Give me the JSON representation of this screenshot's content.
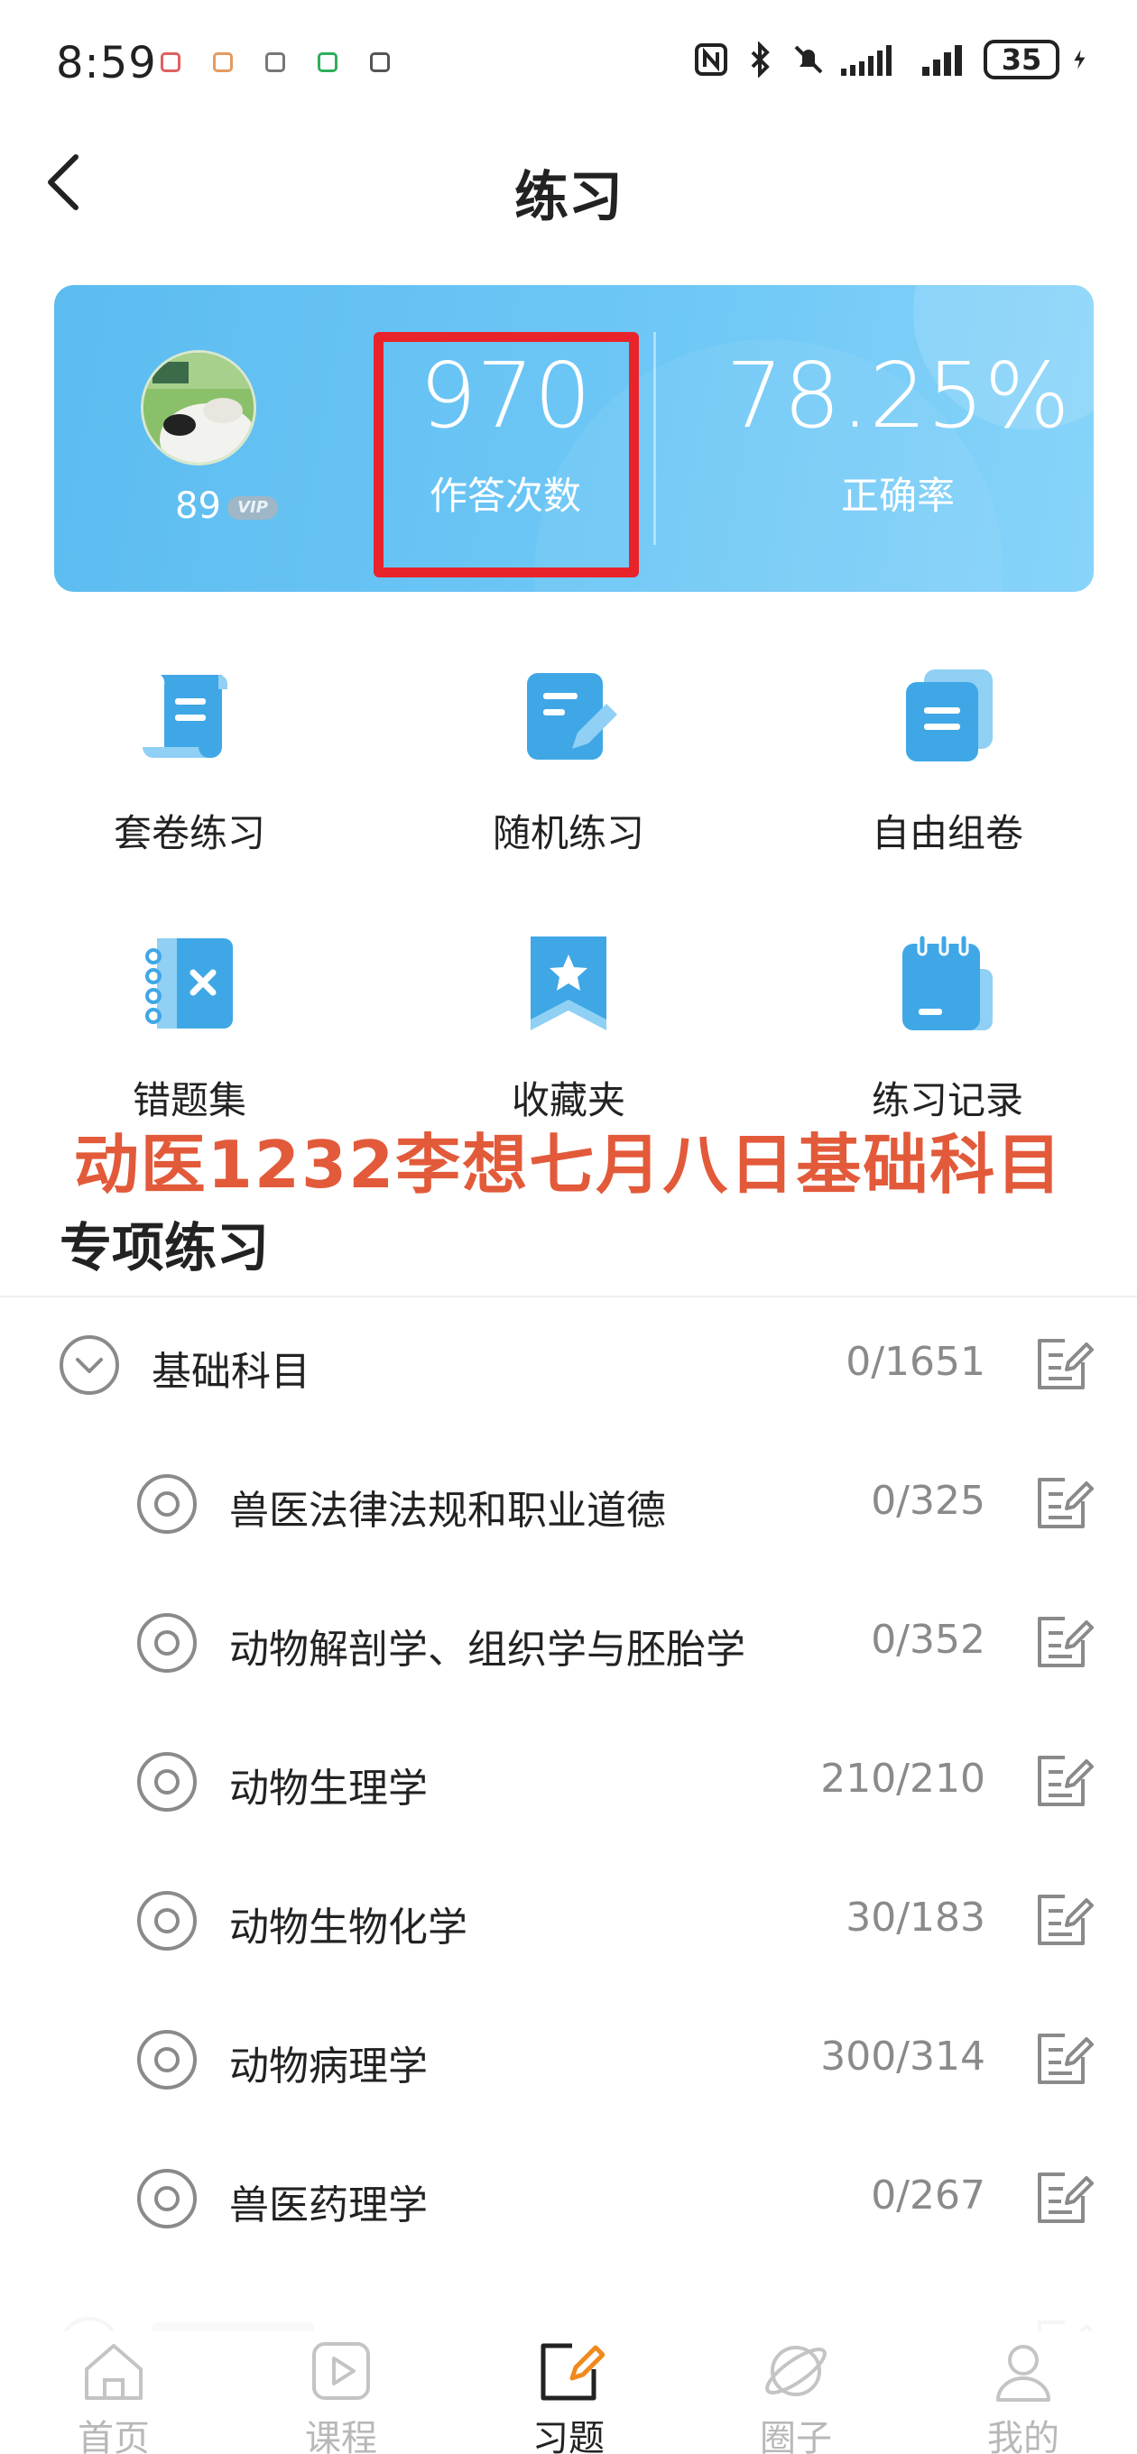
{
  "status_bar": {
    "time": "8:59",
    "battery": "35"
  },
  "nav": {
    "title": "练习"
  },
  "stats": {
    "level": "89",
    "vip": "VIP",
    "answer_count": "970",
    "answer_count_label": "作答次数",
    "accuracy": "78.25%",
    "accuracy_label": "正确率"
  },
  "grid": [
    {
      "label": "套卷练习",
      "icon": "scroll-doc-icon"
    },
    {
      "label": "随机练习",
      "icon": "doc-pencil-icon"
    },
    {
      "label": "自由组卷",
      "icon": "stacked-doc-icon"
    },
    {
      "label": "错题集",
      "icon": "notebook-x-icon"
    },
    {
      "label": "收藏夹",
      "icon": "bookmark-star-icon"
    },
    {
      "label": "练习记录",
      "icon": "record-notepad-icon"
    }
  ],
  "watermark": "动医1232李想七月八日基础科目",
  "section_title": "专项练习",
  "list": [
    {
      "label": "基础科目",
      "count": "0/1651"
    },
    {
      "label": "兽医法律法规和职业道德",
      "count": "0/325"
    },
    {
      "label": "动物解剖学、组织学与胚胎学",
      "count": "0/352"
    },
    {
      "label": "动物生理学",
      "count": "210/210"
    },
    {
      "label": "动物生物化学",
      "count": "30/183"
    },
    {
      "label": "动物病理学",
      "count": "300/314"
    },
    {
      "label": "兽医药理学",
      "count": "0/267"
    }
  ],
  "bottom_nav": [
    {
      "label": "首页",
      "icon": "home-icon"
    },
    {
      "label": "课程",
      "icon": "course-play-icon"
    },
    {
      "label": "习题",
      "icon": "exercise-edit-icon"
    },
    {
      "label": "圈子",
      "icon": "planet-icon"
    },
    {
      "label": "我的",
      "icon": "profile-icon"
    }
  ],
  "colors": {
    "accent": "#5cbcf0",
    "highlight": "#e8242a",
    "watermark": "#e25a3a",
    "icon_blue": "#3fa7e6"
  }
}
